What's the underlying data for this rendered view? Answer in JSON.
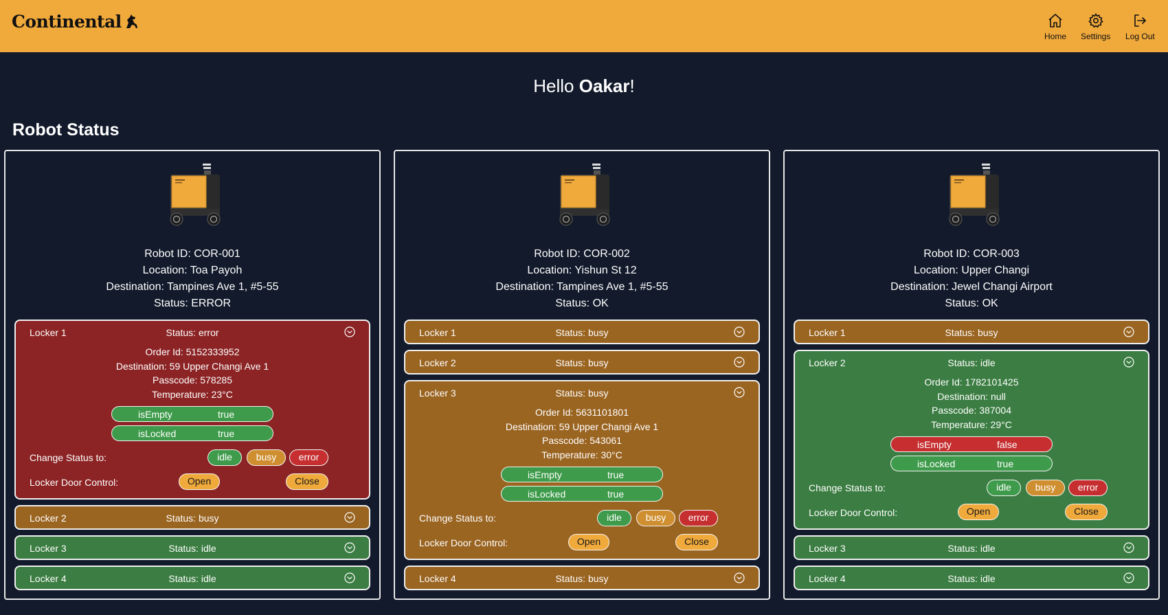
{
  "header": {
    "logo_text": "Continental",
    "nav": [
      {
        "label": "Home",
        "icon": "home-icon"
      },
      {
        "label": "Settings",
        "icon": "gear-icon"
      },
      {
        "label": "Log Out",
        "icon": "logout-icon"
      }
    ]
  },
  "greeting": {
    "prefix": "Hello ",
    "name": "Oakar",
    "suffix": "!"
  },
  "section_title": "Robot Status",
  "labels": {
    "robot_id": "Robot ID: ",
    "location": "Location: ",
    "destination": "Destination: ",
    "status": "Status: ",
    "order_id": "Order Id: ",
    "passcode": "Passcode: ",
    "temperature": "Temperature: ",
    "is_empty": "isEmpty",
    "is_locked": "isLocked",
    "change_status": "Change Status to:",
    "door_control": "Locker Door Control:",
    "btn_idle": "idle",
    "btn_busy": "busy",
    "btn_error": "error",
    "btn_open": "Open",
    "btn_close": "Close"
  },
  "colors": {
    "header": "#f0a93b",
    "background": "#121a2b",
    "error": "#8c2425",
    "busy": "#9a6421",
    "idle": "#3b7d42"
  },
  "robots": [
    {
      "id": "COR-001",
      "location": "Toa Payoh",
      "destination": "Tampines Ave 1, #5-55",
      "status": "ERROR",
      "lockers": [
        {
          "name": "Locker 1",
          "status": "error",
          "expanded": true,
          "order_id": "5152333952",
          "destination": "59 Upper Changi Ave 1",
          "passcode": "578285",
          "temperature": "23°C",
          "is_empty": "true",
          "is_locked": "true"
        },
        {
          "name": "Locker 2",
          "status": "busy",
          "expanded": false
        },
        {
          "name": "Locker 3",
          "status": "idle",
          "expanded": false
        },
        {
          "name": "Locker 4",
          "status": "idle",
          "expanded": false
        }
      ]
    },
    {
      "id": "COR-002",
      "location": "Yishun St 12",
      "destination": "Tampines Ave 1, #5-55",
      "status": "OK",
      "lockers": [
        {
          "name": "Locker 1",
          "status": "busy",
          "expanded": false
        },
        {
          "name": "Locker 2",
          "status": "busy",
          "expanded": false
        },
        {
          "name": "Locker 3",
          "status": "busy",
          "expanded": true,
          "order_id": "5631101801",
          "destination": "59 Upper Changi Ave 1",
          "passcode": "543061",
          "temperature": "30°C",
          "is_empty": "true",
          "is_locked": "true"
        },
        {
          "name": "Locker 4",
          "status": "busy",
          "expanded": false
        }
      ]
    },
    {
      "id": "COR-003",
      "location": "Upper Changi",
      "destination": "Jewel Changi Airport",
      "status": "OK",
      "lockers": [
        {
          "name": "Locker 1",
          "status": "busy",
          "expanded": false
        },
        {
          "name": "Locker 2",
          "status": "idle",
          "expanded": true,
          "order_id": "1782101425",
          "destination": "null",
          "passcode": "387004",
          "temperature": "29°C",
          "is_empty": "false",
          "is_locked": "true"
        },
        {
          "name": "Locker 3",
          "status": "idle",
          "expanded": false
        },
        {
          "name": "Locker 4",
          "status": "idle",
          "expanded": false
        }
      ]
    }
  ]
}
